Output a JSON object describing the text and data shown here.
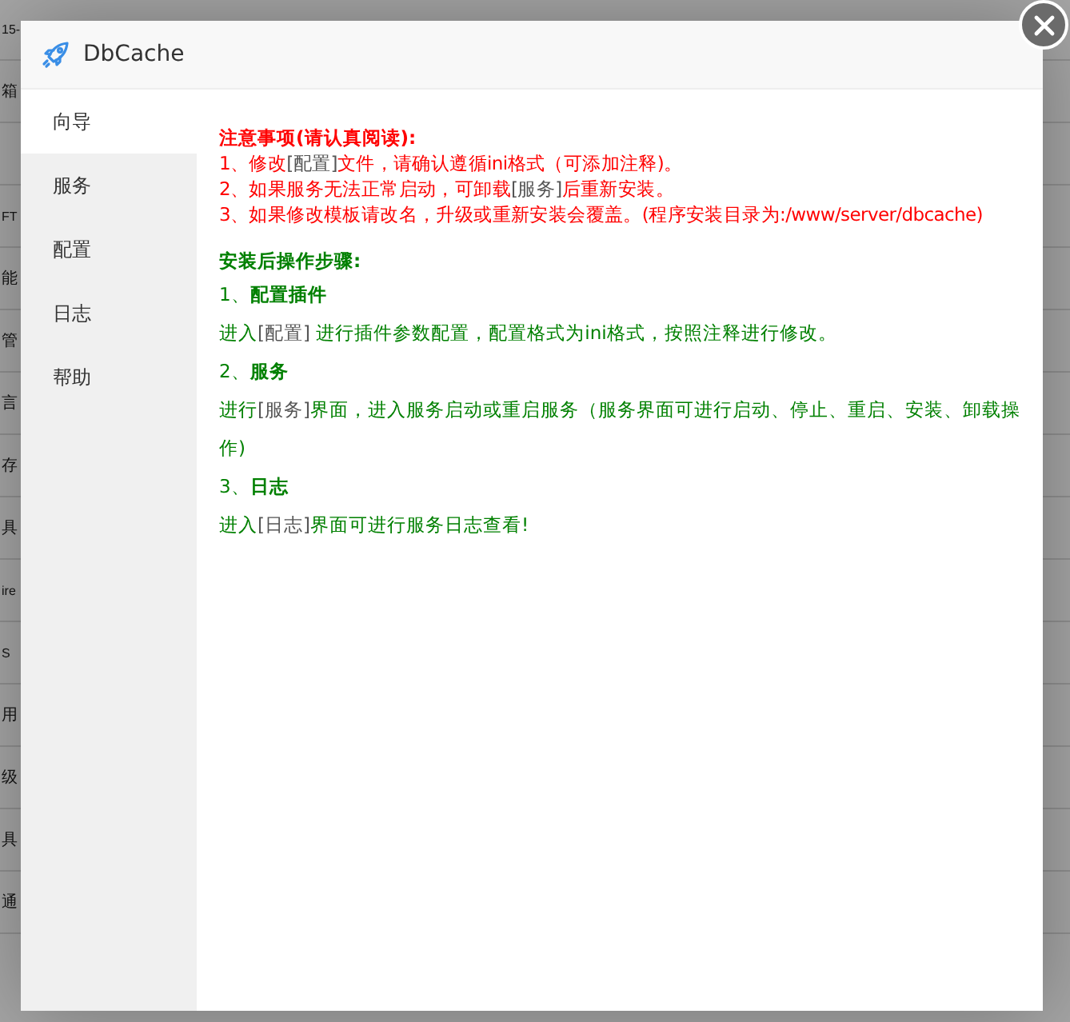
{
  "background_rows": [
    {
      "text": "15-"
    },
    {
      "text": "箱"
    },
    {},
    {
      "text": "FT"
    },
    {
      "text": "能"
    },
    {
      "text": "管"
    },
    {
      "text": "言"
    },
    {
      "text": "存"
    },
    {
      "text": "具"
    },
    {
      "text": "ire"
    },
    {
      "text": "S"
    },
    {
      "text": "用"
    },
    {
      "text": "级"
    },
    {
      "text": "具"
    },
    {
      "text": "通"
    }
  ],
  "dialog": {
    "title": "DbCache",
    "tabs": [
      {
        "label": "向导",
        "selected": true
      },
      {
        "label": "服务",
        "selected": false
      },
      {
        "label": "配置",
        "selected": false
      },
      {
        "label": "日志",
        "selected": false
      },
      {
        "label": "帮助",
        "selected": false
      }
    ],
    "notice": {
      "heading": "注意事项(请认真阅读):",
      "lines": [
        [
          {
            "text": "1、修改"
          },
          {
            "text": "[配置]",
            "kind": "ref"
          },
          {
            "text": "文件，请确认遵循ini格式（可添加注释)。"
          }
        ],
        [
          {
            "text": "2、如果服务无法正常启动，可卸载"
          },
          {
            "text": "[服务]",
            "kind": "ref"
          },
          {
            "text": "后重新安装。"
          }
        ],
        [
          {
            "text": "3、如果修改模板请改名，升级或重新安装会覆盖。(程序安装目录为:/www/server/dbcache)"
          }
        ]
      ]
    },
    "steps": {
      "heading": "安装后操作步骤:",
      "items": [
        {
          "title": "1、**配置插件**",
          "body": [
            {
              "text": "进入"
            },
            {
              "text": "[配置]",
              "kind": "ref"
            },
            {
              "text": " 进行插件参数配置，配置格式为ini格式，按照注释进行修改。"
            }
          ]
        },
        {
          "title": "2、**服务**",
          "body": [
            {
              "text": "进行"
            },
            {
              "text": "[服务]",
              "kind": "ref"
            },
            {
              "text": "界面，进入服务启动或重启服务（服务界面可进行启动、停止、重启、安装、卸载操作)"
            }
          ]
        },
        {
          "title": "3、**日志**",
          "body": [
            {
              "text": "进入"
            },
            {
              "text": "[日志]",
              "kind": "ref"
            },
            {
              "text": "界面可进行服务日志查看!"
            }
          ]
        }
      ]
    }
  }
}
